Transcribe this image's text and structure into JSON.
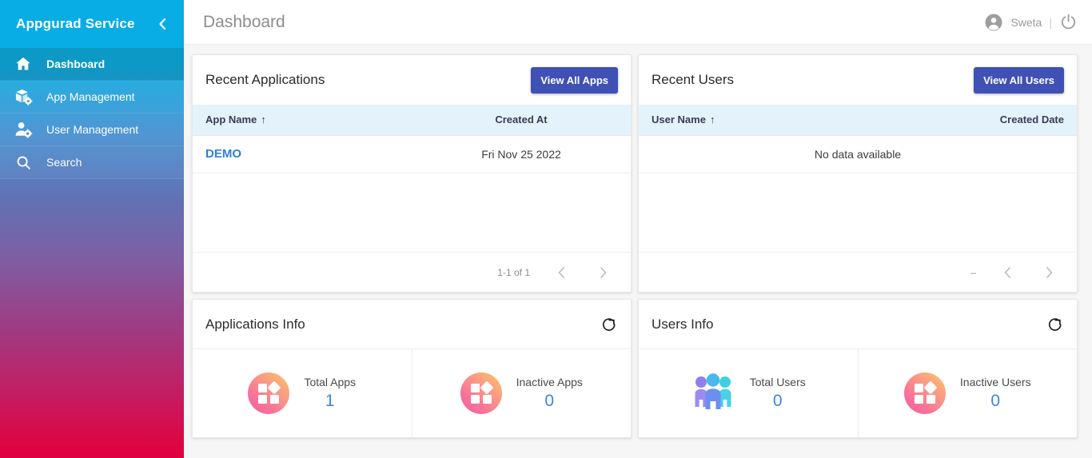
{
  "sidebar": {
    "brand": "Appgurad Service",
    "collapse_icon": "chevron-left-icon",
    "items": [
      {
        "label": "Dashboard",
        "icon": "home-icon",
        "active": true
      },
      {
        "label": "App Management",
        "icon": "box-gear-icon",
        "active": false
      },
      {
        "label": "User Management",
        "icon": "user-gear-icon",
        "active": false
      },
      {
        "label": "Search",
        "icon": "search-icon",
        "active": false
      }
    ]
  },
  "topbar": {
    "page_title": "Dashboard",
    "account_icon": "account-circle-icon",
    "user_name": "Sweta",
    "separator": "|",
    "power_icon": "power-icon"
  },
  "recent_applications": {
    "title": "Recent Applications",
    "action_label": "View All Apps",
    "columns": [
      "App Name",
      "Created At"
    ],
    "sort_indicator": "↑",
    "rows": [
      {
        "app_name": "DEMO",
        "created_at": "Fri Nov 25 2022"
      }
    ],
    "pager": {
      "range": "1-1 of 1",
      "prev_icon": "chevron-left-icon",
      "next_icon": "chevron-right-icon"
    }
  },
  "recent_users": {
    "title": "Recent Users",
    "action_label": "View All Users",
    "columns": [
      "User Name",
      "Created Date"
    ],
    "sort_indicator": "↑",
    "empty_text": "No data available",
    "pager": {
      "range": "–",
      "prev_icon": "chevron-left-icon",
      "next_icon": "chevron-right-icon"
    }
  },
  "applications_info": {
    "title": "Applications Info",
    "refresh_icon": "refresh-icon",
    "stats": [
      {
        "label": "Total Apps",
        "value": "1",
        "icon": "app-tile-icon"
      },
      {
        "label": "Inactive Apps",
        "value": "0",
        "icon": "app-tile-icon"
      }
    ]
  },
  "users_info": {
    "title": "Users Info",
    "refresh_icon": "refresh-icon",
    "stats": [
      {
        "label": "Total Users",
        "value": "0",
        "icon": "users-group-icon"
      },
      {
        "label": "Inactive Users",
        "value": "0",
        "icon": "app-tile-icon"
      }
    ]
  },
  "colors": {
    "sidebar_top": "#0fb0e4",
    "sidebar_bottom": "#e00040",
    "brand_header": "#08ade6",
    "primary_button": "#3f51b5",
    "table_header_bg": "#e4f3fb",
    "link": "#2f7fd8",
    "stat_value": "#3b87dd"
  }
}
